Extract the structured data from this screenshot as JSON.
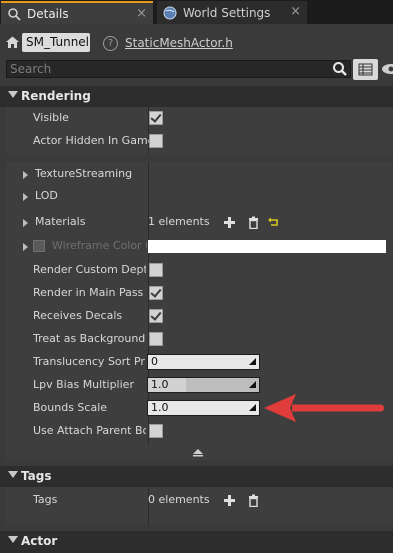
{
  "tabs": [
    {
      "label": "Details",
      "close": "×"
    },
    {
      "label": "World Settings",
      "close": "×"
    }
  ],
  "header": {
    "actor_name": "SM_Tunnel",
    "help": "?",
    "class_link": "StaticMeshActor.h",
    "search_placeholder": "Search"
  },
  "rendering": {
    "title": "Rendering",
    "visible_label": "Visible",
    "visible_checked": true,
    "hidden_label": "Actor Hidden In Game",
    "hidden_checked": false,
    "texture_streaming": "TextureStreaming",
    "lod": "LOD",
    "materials_label": "Materials",
    "materials_value": "1 elements",
    "wireframe_label": "Wireframe Color O",
    "custom_depth_label": "Render Custom Depth",
    "custom_depth_checked": false,
    "main_pass_label": "Render in Main Pass",
    "main_pass_checked": true,
    "decals_label": "Receives Decals",
    "decals_checked": true,
    "background_label": "Treat as Background f",
    "background_checked": false,
    "sort_label": "Translucency Sort Pri",
    "sort_value": "0",
    "lpv_label": "Lpv Bias Multiplier",
    "lpv_value": "1.0",
    "bounds_label": "Bounds Scale",
    "bounds_value": "1.0",
    "attach_label": "Use Attach Parent Bo",
    "attach_checked": false
  },
  "tags": {
    "title": "Tags",
    "label": "Tags",
    "value": "0 elements"
  },
  "actor": {
    "title": "Actor"
  },
  "colors": {
    "accent": "#e59a1a",
    "annotation_arrow": "#e03c3c"
  }
}
